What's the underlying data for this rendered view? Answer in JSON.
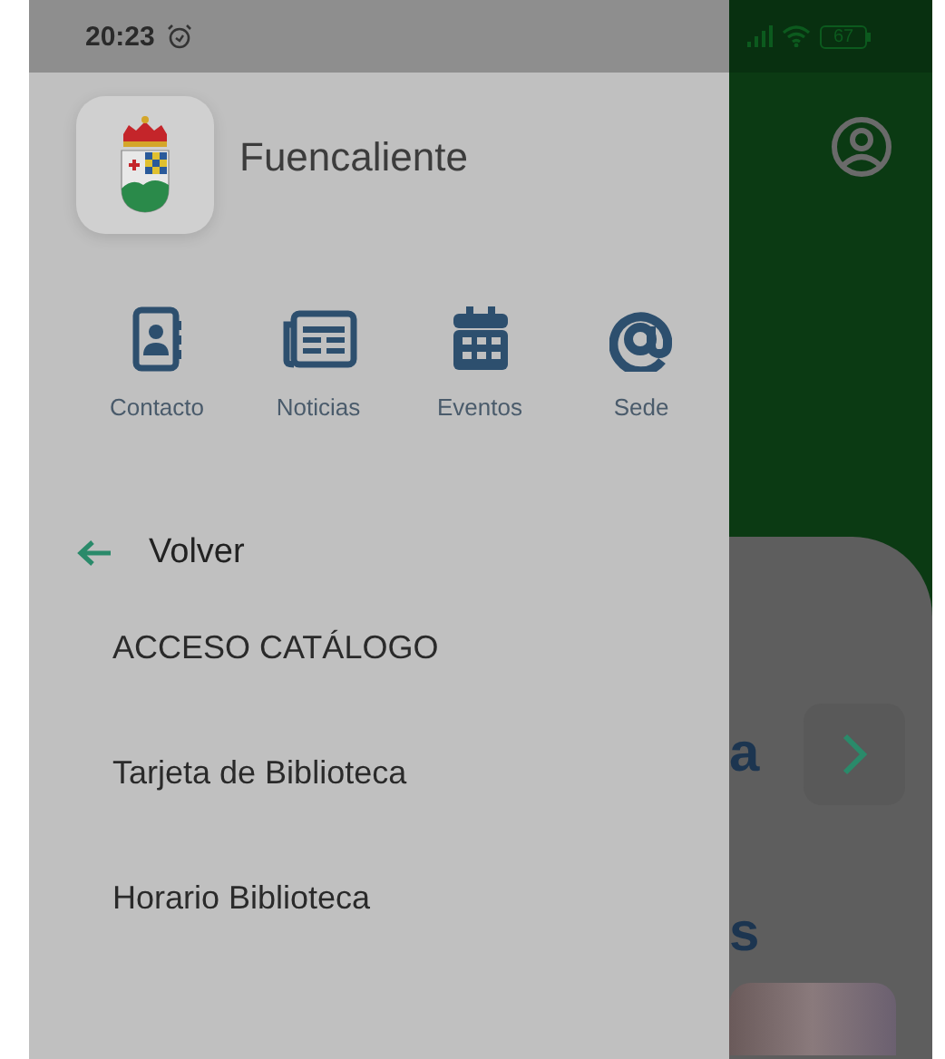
{
  "status_bar": {
    "time": "20:23",
    "battery": "67"
  },
  "drawer": {
    "title": "Fuencaliente",
    "shortcuts": [
      {
        "label": "Contacto",
        "kind": "contact"
      },
      {
        "label": "Noticias",
        "kind": "news"
      },
      {
        "label": "Eventos",
        "kind": "calendar"
      },
      {
        "label": "Sede",
        "kind": "email"
      }
    ],
    "back": "Volver",
    "items": [
      "ACCESO CATÁLOGO",
      "Tarjeta de Biblioteca",
      "Horario Biblioteca"
    ]
  },
  "background": {
    "heading_fragment": "a",
    "section_fragment": "s"
  }
}
